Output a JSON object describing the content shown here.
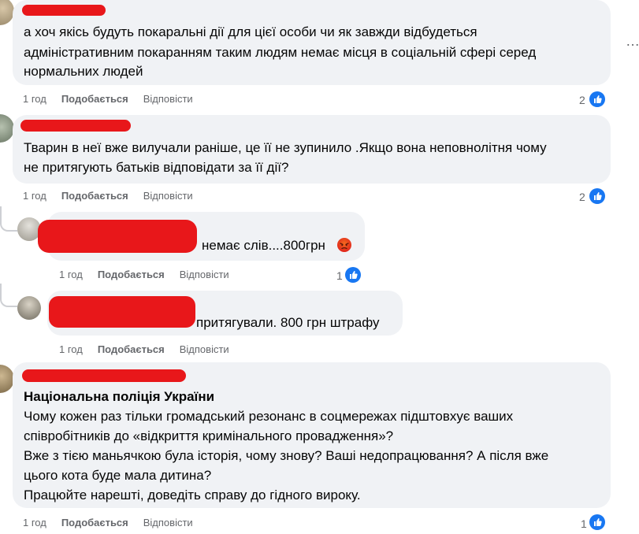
{
  "comments": [
    {
      "text_lines": [
        "а хоч якісь будуть покаральні дії для цієї особи чи як завжди відбудеться",
        "адміністративним покаранням таким людям немає місця в соціальній сфері серед",
        "нормальних людей"
      ],
      "time": "1 год",
      "like_label": "Подобається",
      "reply_label": "Відповісти",
      "reactions": "2"
    },
    {
      "text_lines": [
        "Тварин в неї вже вилучали раніше, це її не зупинило .Якщо вона неповнолітня чому",
        "не притягують батьків відповідати за її дії?"
      ],
      "time": "1 год",
      "like_label": "Подобається",
      "reply_label": "Відповісти",
      "reactions": "2"
    },
    {
      "text_lines": [
        "немає слів....800грн"
      ],
      "time": "1 год",
      "like_label": "Подобається",
      "reply_label": "Відповісти",
      "reactions": "1",
      "emoji": "angry-face-emoji"
    },
    {
      "text_lines": [
        "притягували. 800 грн штрафу"
      ],
      "time": "1 год",
      "like_label": "Подобається",
      "reply_label": "Відповісти"
    },
    {
      "mention": "Національна поліція України",
      "text_lines": [
        "Чому кожен раз тільки громадський резонанс в соцмережах підштовхує ваших",
        "співробітників до «відкриття кримінального провадження»?",
        "Вже з тією маньячкою була історія, чому знову? Ваші недопрацювання? А після вже",
        "цього кота буде мала дитина?",
        "Працюйте нарешті, доведіть справу до гідного вироку."
      ],
      "time": "1 год",
      "like_label": "Подобається",
      "reply_label": "Відповісти",
      "reactions": "1"
    }
  ],
  "colors": {
    "bubble": "#f0f2f5",
    "meta_text": "#65676b",
    "like_blue": "#1877f2",
    "redaction": "#e8171a"
  }
}
